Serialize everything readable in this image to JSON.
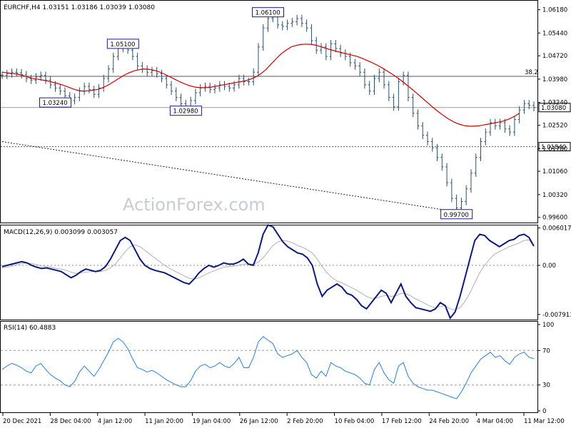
{
  "chart_data": [
    {
      "type": "bar",
      "title": "EURCHF,H4 1.03151 1.03186 1.03039 1.03080",
      "series_name": "EURCHF,H4",
      "ohlc_last": {
        "open": 1.03151,
        "high": 1.03186,
        "low": 1.03039,
        "close": 1.0308
      },
      "ylim": [
        0.9948,
        1.0642
      ],
      "y_ticks": [
        "1.06180",
        "1.05440",
        "1.04720",
        "1.03980",
        "1.03240",
        "1.02520",
        "1.01780",
        "1.01060",
        "1.00320",
        "0.99600"
      ],
      "x_ticks": [
        "20 Dec 2021",
        "28 Dec 04:00",
        "4 Jan 12:00",
        "11 Jan 20:00",
        "19 Jan 04:00",
        "26 Jan 12:00",
        "2 Feb 20:00",
        "10 Feb 04:00",
        "17 Feb 12:00",
        "24 Feb 20:00",
        "4 Mar 04:00",
        "11 Mar 12:00"
      ],
      "close": [
        1.041,
        1.0415,
        1.042,
        1.0418,
        1.0412,
        1.04,
        1.0395,
        1.0405,
        1.041,
        1.0395,
        1.038,
        1.037,
        1.036,
        1.0345,
        1.033,
        1.034,
        1.036,
        1.0375,
        1.0365,
        1.035,
        1.037,
        1.04,
        1.043,
        1.047,
        1.0495,
        1.05,
        1.049,
        1.047,
        1.044,
        1.043,
        1.042,
        1.0425,
        1.0415,
        1.04,
        1.038,
        1.036,
        1.034,
        1.032,
        1.031,
        1.033,
        1.0355,
        1.037,
        1.0375,
        1.0365,
        1.037,
        1.038,
        1.0375,
        1.037,
        1.038,
        1.04,
        1.039,
        1.039,
        1.042,
        1.05,
        1.056,
        1.059,
        1.0595,
        1.057,
        1.0565,
        1.0575,
        1.058,
        1.059,
        1.0575,
        1.056,
        1.052,
        1.049,
        1.05,
        1.047,
        1.051,
        1.0495,
        1.048,
        1.047,
        1.045,
        1.044,
        1.042,
        1.038,
        1.036,
        1.04,
        1.042,
        1.038,
        1.034,
        1.031,
        1.039,
        1.041,
        1.034,
        1.029,
        1.025,
        1.022,
        1.02,
        1.018,
        1.015,
        1.012,
        1.007,
        1.002,
        0.999,
        1.001,
        1.005,
        1.01,
        1.015,
        1.02,
        1.023,
        1.026,
        1.025,
        1.026,
        1.024,
        1.023,
        1.027,
        1.03,
        1.032,
        1.0315,
        1.0308
      ],
      "ma_close": [
        1.042,
        1.0418,
        1.0416,
        1.0414,
        1.041,
        1.0405,
        1.04,
        1.0398,
        1.0395,
        1.0392,
        1.0388,
        1.0384,
        1.0379,
        1.0373,
        1.0367,
        1.0362,
        1.036,
        1.0361,
        1.0363,
        1.0366,
        1.0372,
        1.038,
        1.039,
        1.04,
        1.041,
        1.0418,
        1.0424,
        1.0428,
        1.043,
        1.0429,
        1.0426,
        1.0421,
        1.0414,
        1.0406,
        1.0398,
        1.039,
        1.0383,
        1.0377,
        1.0373,
        1.0371,
        1.0371,
        1.0372,
        1.0375,
        1.0378,
        1.0381,
        1.0384,
        1.0387,
        1.039,
        1.0393,
        1.0398,
        1.0405,
        1.0415,
        1.0428,
        1.0445,
        1.0462,
        1.0478,
        1.049,
        1.05,
        1.0505,
        1.0508,
        1.0509,
        1.0508,
        1.0505,
        1.05,
        1.0495,
        1.049,
        1.0486,
        1.0482,
        1.0478,
        1.0474,
        1.047,
        1.0464,
        1.0457,
        1.045,
        1.0442,
        1.0433,
        1.0423,
        1.0413,
        1.0402,
        1.039,
        1.0377,
        1.0364,
        1.035,
        1.0336,
        1.0322,
        1.0308,
        1.0295,
        1.0283,
        1.0272,
        1.0263,
        1.0256,
        1.0251,
        1.0249,
        1.0249,
        1.025,
        1.0253,
        1.0256,
        1.0259,
        1.0262,
        1.0266,
        1.0272,
        1.028,
        1.029
      ],
      "horizontal_lines": [
        {
          "label": "38.2",
          "value": 1.0407,
          "color": "#555555",
          "style": "solid"
        },
        {
          "label": "1.03080",
          "value": 1.0308,
          "color": "#9a9a9a",
          "style": "solid"
        },
        {
          "label": "1.01840",
          "value": 1.0184,
          "color": "#555555",
          "style": "dashed"
        }
      ],
      "trendline": {
        "from": {
          "x_index": 0,
          "y": 1.02
        },
        "to": {
          "x_index": 93,
          "y": 0.998
        }
      },
      "annotations": [
        {
          "text": "1.06100",
          "x_index": 55,
          "y": 1.061
        },
        {
          "text": "1.05100",
          "x_index": 25,
          "y": 1.051
        },
        {
          "text": "1.03240",
          "x_index": 11,
          "y": 1.0324
        },
        {
          "text": "1.02980",
          "x_index": 38,
          "y": 1.0298
        },
        {
          "text": "0.99700",
          "x_index": 94,
          "y": 0.997
        }
      ],
      "colors": {
        "price": "#2c4f6b",
        "ma": "#cc0000",
        "annotation_box": "#1a1a8c"
      }
    },
    {
      "type": "line",
      "title": "MACD(12,26,9) 0.003099 0.003057",
      "series": [
        {
          "name": "MACD",
          "color": "#0b1a7a",
          "values": [
            -0.0002,
            0.0,
            0.0002,
            0.0004,
            0.0006,
            0.0004,
            0.0,
            -0.0003,
            -0.0005,
            -0.0004,
            -0.0006,
            -0.0008,
            -0.001,
            -0.0015,
            -0.002,
            -0.0016,
            -0.001,
            -0.0006,
            -0.0008,
            -0.001,
            -0.0008,
            -0.0002,
            0.001,
            0.0025,
            0.004,
            0.0045,
            0.004,
            0.0025,
            0.001,
            0.0,
            -0.0005,
            -0.0008,
            -0.001,
            -0.0012,
            -0.0016,
            -0.002,
            -0.0024,
            -0.0028,
            -0.003,
            -0.0022,
            -0.0012,
            -0.0005,
            0.0,
            -0.0003,
            0.0,
            0.0004,
            0.0002,
            0.0002,
            0.0005,
            0.001,
            0.0002,
            0.0,
            0.002,
            0.005,
            0.0065,
            0.0062,
            0.005,
            0.0038,
            0.003,
            0.0025,
            0.002,
            0.0018,
            0.0012,
            0.0,
            -0.003,
            -0.005,
            -0.004,
            -0.0035,
            -0.003,
            -0.0035,
            -0.0045,
            -0.0048,
            -0.0055,
            -0.0065,
            -0.007,
            -0.006,
            -0.005,
            -0.004,
            -0.0045,
            -0.006,
            -0.0045,
            -0.003,
            -0.005,
            -0.006,
            -0.0068,
            -0.007,
            -0.0072,
            -0.0074,
            -0.007,
            -0.006,
            -0.0065,
            -0.0085,
            -0.0075,
            -0.005,
            -0.002,
            0.001,
            0.004,
            0.005,
            0.0048,
            0.004,
            0.0035,
            0.003,
            0.0035,
            0.004,
            0.0042,
            0.0048,
            0.005,
            0.0045,
            0.0031
          ]
        },
        {
          "name": "Signal",
          "color": "#b0b0b0",
          "values": [
            -0.0004,
            -0.0003,
            -0.0001,
            0.0001,
            0.0003,
            0.0004,
            0.0003,
            0.0001,
            -0.0001,
            -0.0002,
            -0.0003,
            -0.0005,
            -0.0006,
            -0.0008,
            -0.0011,
            -0.0013,
            -0.0012,
            -0.0011,
            -0.001,
            -0.001,
            -0.001,
            -0.0008,
            -0.0004,
            0.0002,
            0.0012,
            0.0022,
            0.003,
            0.0033,
            0.003,
            0.0024,
            0.0018,
            0.0012,
            0.0006,
            0.0,
            -0.0005,
            -0.0009,
            -0.0013,
            -0.0017,
            -0.0021,
            -0.0022,
            -0.002,
            -0.0016,
            -0.0012,
            -0.0009,
            -0.0006,
            -0.0003,
            -0.0002,
            -0.0001,
            0.0,
            0.0002,
            0.0002,
            0.0002,
            0.0005,
            0.0012,
            0.0022,
            0.0032,
            0.0038,
            0.004,
            0.0039,
            0.0036,
            0.0032,
            0.0029,
            0.0025,
            0.002,
            0.001,
            -0.0002,
            -0.0012,
            -0.002,
            -0.0025,
            -0.0028,
            -0.0032,
            -0.0036,
            -0.004,
            -0.0045,
            -0.005,
            -0.0053,
            -0.0053,
            -0.005,
            -0.0048,
            -0.005,
            -0.0049,
            -0.0045,
            -0.0046,
            -0.0049,
            -0.0054,
            -0.0058,
            -0.0062,
            -0.0066,
            -0.0068,
            -0.0066,
            -0.0065,
            -0.007,
            -0.0072,
            -0.0068,
            -0.0058,
            -0.0045,
            -0.0028,
            -0.0012,
            0.0,
            0.001,
            0.0018,
            0.0022,
            0.0026,
            0.003,
            0.0033,
            0.0036,
            0.004,
            0.0041,
            0.0031
          ]
        }
      ],
      "ylim": [
        -0.0085,
        0.0062
      ],
      "y_ticks": [
        "0.006017",
        "0.00",
        "-0.007911"
      ],
      "zero_line": true
    },
    {
      "type": "line",
      "title": "RSI(14) 60.4883",
      "series": [
        {
          "name": "RSI",
          "color": "#2a7fd4",
          "values": [
            48,
            52,
            55,
            53,
            50,
            46,
            44,
            52,
            55,
            48,
            42,
            38,
            35,
            30,
            28,
            34,
            45,
            52,
            46,
            40,
            48,
            58,
            68,
            80,
            84,
            80,
            72,
            60,
            50,
            48,
            45,
            47,
            44,
            40,
            36,
            33,
            30,
            28,
            28,
            35,
            46,
            52,
            54,
            50,
            52,
            56,
            52,
            50,
            55,
            62,
            50,
            50,
            62,
            80,
            86,
            82,
            78,
            66,
            62,
            64,
            66,
            70,
            62,
            56,
            42,
            38,
            46,
            40,
            56,
            52,
            50,
            46,
            44,
            42,
            38,
            32,
            30,
            48,
            56,
            44,
            36,
            32,
            52,
            56,
            40,
            32,
            28,
            26,
            24,
            24,
            22,
            20,
            18,
            16,
            14,
            22,
            32,
            44,
            52,
            60,
            64,
            68,
            62,
            64,
            58,
            54,
            62,
            66,
            68,
            62,
            60.5
          ]
        }
      ],
      "ylim": [
        0,
        100
      ],
      "y_ticks": [
        "100",
        "70",
        "30",
        "0"
      ],
      "levels": [
        70,
        30
      ]
    }
  ],
  "watermark": "ActionForex.com"
}
